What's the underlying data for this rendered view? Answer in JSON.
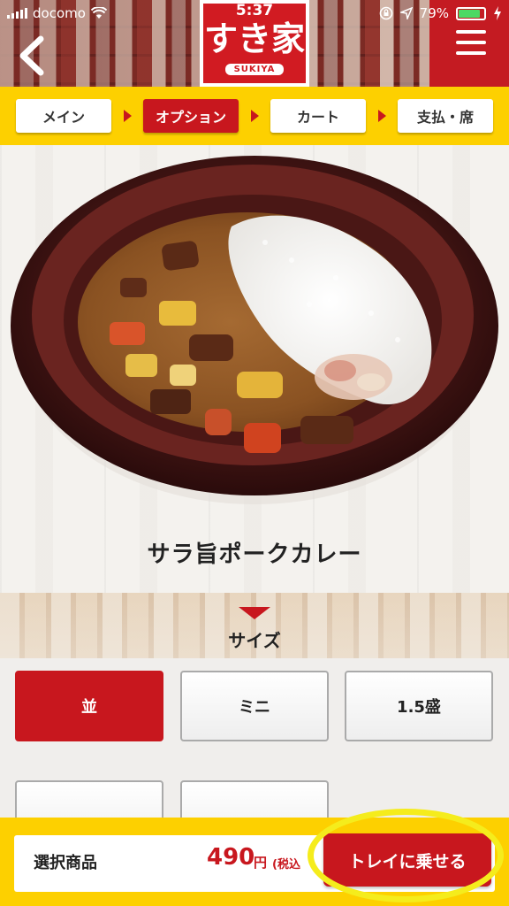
{
  "status_bar": {
    "carrier": "docomo",
    "time": "5:37",
    "battery": "79%",
    "battery_level": 0.79
  },
  "header": {
    "logo_text": "すき家",
    "logo_romaji": "SUKIYA"
  },
  "steps": [
    {
      "label": "メイン",
      "active": false
    },
    {
      "label": "オプション",
      "active": true
    },
    {
      "label": "カート",
      "active": false
    },
    {
      "label": "支払・席",
      "active": false
    }
  ],
  "product": {
    "name": "サラ旨ポークカレー"
  },
  "size": {
    "label": "サイズ",
    "options": [
      {
        "label": "並",
        "selected": true
      },
      {
        "label": "ミニ",
        "selected": false
      },
      {
        "label": "1.5盛",
        "selected": false
      },
      {
        "label": "",
        "selected": false
      },
      {
        "label": "",
        "selected": false
      }
    ]
  },
  "footer": {
    "selected_label": "選択商品",
    "price": "490",
    "price_unit": "円",
    "tax_note": "(税込",
    "add_to_tray": "トレイに乗せる"
  },
  "colors": {
    "brand_red": "#c8171e",
    "step_yellow": "#fdd000",
    "highlight": "#f5ec1c"
  },
  "icons": [
    "back-chevron-icon",
    "hamburger-menu-icon",
    "signal-icon",
    "wifi-icon",
    "lock-rotation-icon",
    "location-icon",
    "battery-icon",
    "charging-icon"
  ]
}
